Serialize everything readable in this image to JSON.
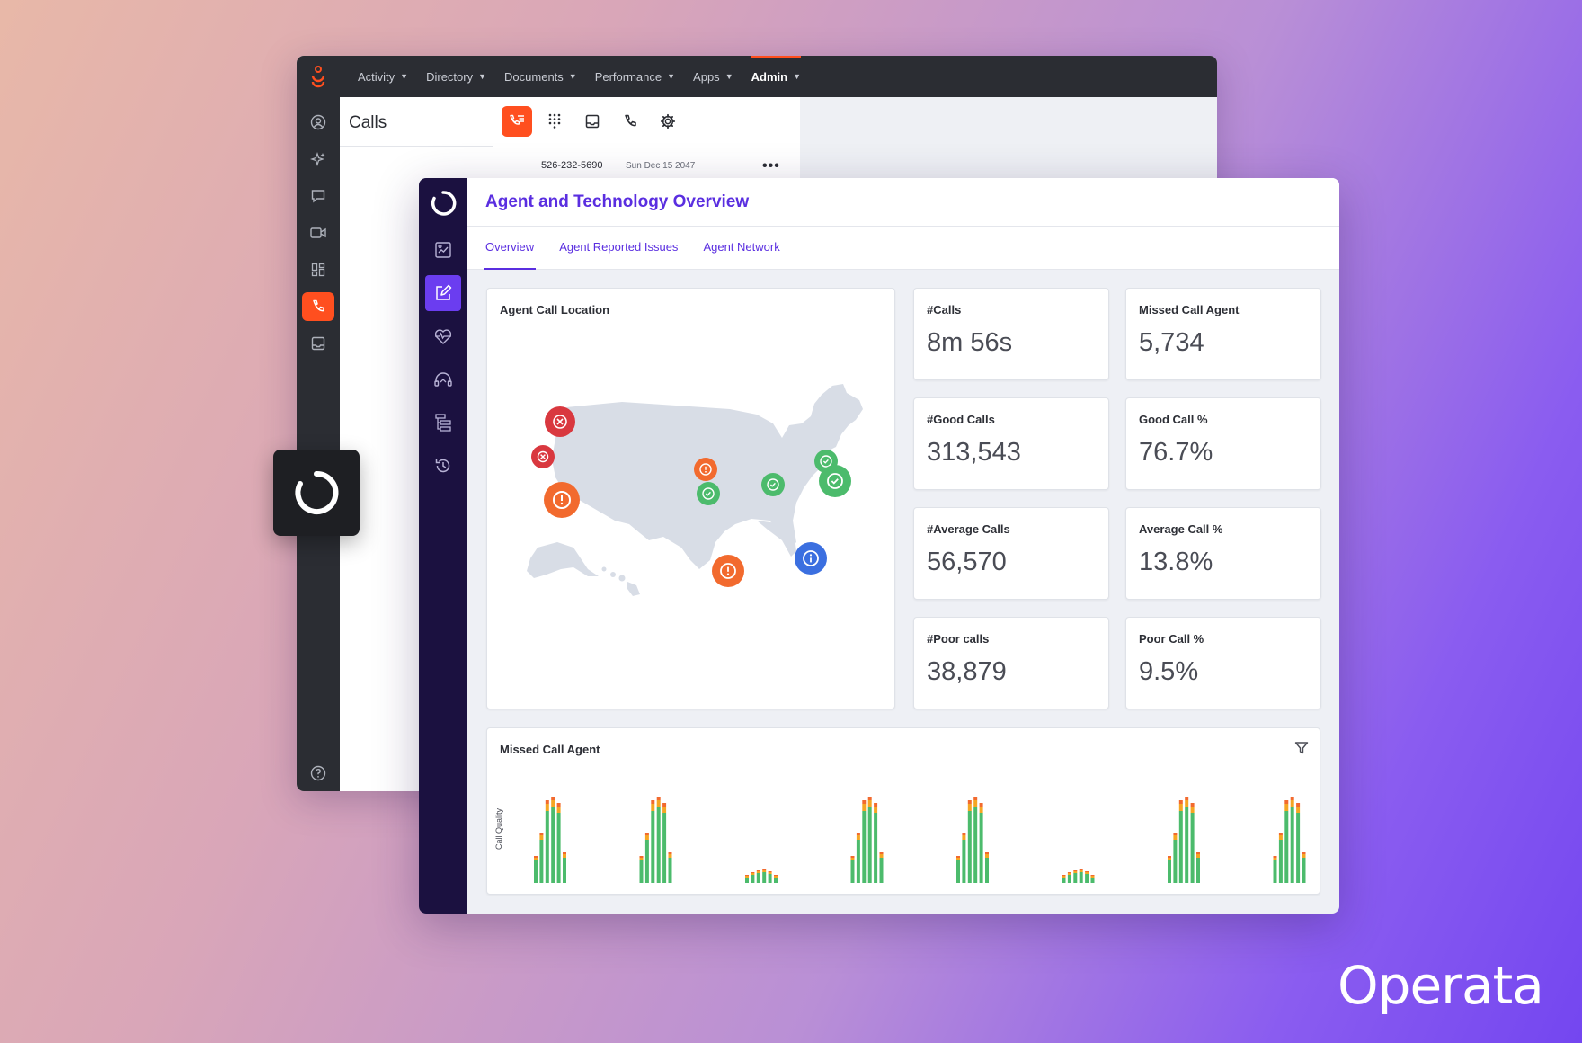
{
  "back_window": {
    "nav": [
      {
        "label": "Activity",
        "active": false
      },
      {
        "label": "Directory",
        "active": false
      },
      {
        "label": "Documents",
        "active": false
      },
      {
        "label": "Performance",
        "active": false
      },
      {
        "label": "Apps",
        "active": false
      },
      {
        "label": "Admin",
        "active": true
      }
    ],
    "sidebar_icons": [
      "user-circle-icon",
      "sparkle-icon",
      "chat-icon",
      "video-icon",
      "dashboard-icon",
      "phone-icon",
      "inbox-icon",
      "help-icon"
    ],
    "calls": {
      "title": "Calls",
      "toolbar_icons": [
        "call-list-icon",
        "dialpad-icon",
        "inbox-icon",
        "phone-icon",
        "gear-icon"
      ],
      "row_number": "526-232-5690",
      "row_date": "Sun Dec 15 2047"
    }
  },
  "front_window": {
    "title": "Agent and Technology Overview",
    "tabs": [
      {
        "label": "Overview",
        "active": true
      },
      {
        "label": "Agent Reported Issues",
        "active": false
      },
      {
        "label": "Agent Network",
        "active": false
      }
    ],
    "sidebar_icons": [
      "report-icon",
      "edit-icon",
      "heartbeat-icon",
      "headset-icon",
      "hierarchy-icon",
      "history-icon"
    ],
    "map": {
      "title": "Agent Call Location",
      "markers": [
        {
          "status": "error",
          "color": "#d9383f",
          "size": "large"
        },
        {
          "status": "error",
          "color": "#d9383f",
          "size": "small"
        },
        {
          "status": "warning",
          "color": "#f26a2e",
          "size": "large"
        },
        {
          "status": "warning",
          "color": "#f26a2e",
          "size": "small"
        },
        {
          "status": "ok",
          "color": "#4cbb6c",
          "size": "small"
        },
        {
          "status": "ok",
          "color": "#4cbb6c",
          "size": "small"
        },
        {
          "status": "ok",
          "color": "#4cbb6c",
          "size": "small"
        },
        {
          "status": "ok",
          "color": "#4cbb6c",
          "size": "large"
        },
        {
          "status": "warning",
          "color": "#f26a2e",
          "size": "large"
        },
        {
          "status": "info",
          "color": "#3b6fe0",
          "size": "large"
        }
      ]
    },
    "stats": [
      {
        "label": "#Calls",
        "value": "8m 56s"
      },
      {
        "label": "Missed Call Agent",
        "value": "5,734"
      },
      {
        "label": "#Good Calls",
        "value": "313,543"
      },
      {
        "label": "Good Call %",
        "value": "76.7%"
      },
      {
        "label": "#Average Calls",
        "value": "56,570"
      },
      {
        "label": "Average Call %",
        "value": "13.8%"
      },
      {
        "label": "#Poor calls",
        "value": "38,879"
      },
      {
        "label": "Poor Call %",
        "value": "9.5%"
      }
    ],
    "chart_title": "Missed Call Agent"
  },
  "chart_data": {
    "type": "bar",
    "title": "Missed Call Agent",
    "ylabel": "Call Quality",
    "stacked": true,
    "colors": {
      "good": "#4cbb6c",
      "average": "#f5a623",
      "poor": "#f26a2e"
    },
    "groups": [
      [
        [
          0.25,
          0.03,
          0.02
        ],
        [
          0.48,
          0.05,
          0.03
        ],
        [
          0.8,
          0.08,
          0.04
        ],
        [
          0.84,
          0.08,
          0.04
        ],
        [
          0.78,
          0.07,
          0.04
        ],
        [
          0.28,
          0.04,
          0.02
        ]
      ],
      [
        [
          0.25,
          0.03,
          0.02
        ],
        [
          0.48,
          0.05,
          0.03
        ],
        [
          0.8,
          0.08,
          0.04
        ],
        [
          0.84,
          0.08,
          0.04
        ],
        [
          0.78,
          0.07,
          0.04
        ],
        [
          0.28,
          0.04,
          0.02
        ]
      ],
      [
        [
          0.06,
          0.02,
          0.01
        ],
        [
          0.09,
          0.02,
          0.01
        ],
        [
          0.11,
          0.02,
          0.01
        ],
        [
          0.12,
          0.02,
          0.01
        ],
        [
          0.1,
          0.02,
          0.01
        ],
        [
          0.06,
          0.02,
          0.01
        ]
      ],
      [
        [
          0.25,
          0.03,
          0.02
        ],
        [
          0.48,
          0.05,
          0.03
        ],
        [
          0.8,
          0.08,
          0.04
        ],
        [
          0.84,
          0.08,
          0.04
        ],
        [
          0.78,
          0.07,
          0.04
        ],
        [
          0.28,
          0.04,
          0.02
        ]
      ],
      [
        [
          0.25,
          0.03,
          0.02
        ],
        [
          0.48,
          0.05,
          0.03
        ],
        [
          0.8,
          0.08,
          0.04
        ],
        [
          0.84,
          0.08,
          0.04
        ],
        [
          0.78,
          0.07,
          0.04
        ],
        [
          0.28,
          0.04,
          0.02
        ]
      ],
      [
        [
          0.06,
          0.02,
          0.01
        ],
        [
          0.09,
          0.02,
          0.01
        ],
        [
          0.11,
          0.02,
          0.01
        ],
        [
          0.12,
          0.02,
          0.01
        ],
        [
          0.1,
          0.02,
          0.01
        ],
        [
          0.06,
          0.02,
          0.01
        ]
      ],
      [
        [
          0.25,
          0.03,
          0.02
        ],
        [
          0.48,
          0.05,
          0.03
        ],
        [
          0.8,
          0.08,
          0.04
        ],
        [
          0.84,
          0.08,
          0.04
        ],
        [
          0.78,
          0.07,
          0.04
        ],
        [
          0.28,
          0.04,
          0.02
        ]
      ],
      [
        [
          0.25,
          0.03,
          0.02
        ],
        [
          0.48,
          0.05,
          0.03
        ],
        [
          0.8,
          0.08,
          0.04
        ],
        [
          0.84,
          0.08,
          0.04
        ],
        [
          0.78,
          0.07,
          0.04
        ],
        [
          0.28,
          0.04,
          0.02
        ]
      ]
    ]
  },
  "brand": {
    "name": "Operata"
  },
  "colors": {
    "accent_orange": "#ff4f1f",
    "accent_purple": "#5a2ee0",
    "sidebar_dark": "#1b1140"
  }
}
